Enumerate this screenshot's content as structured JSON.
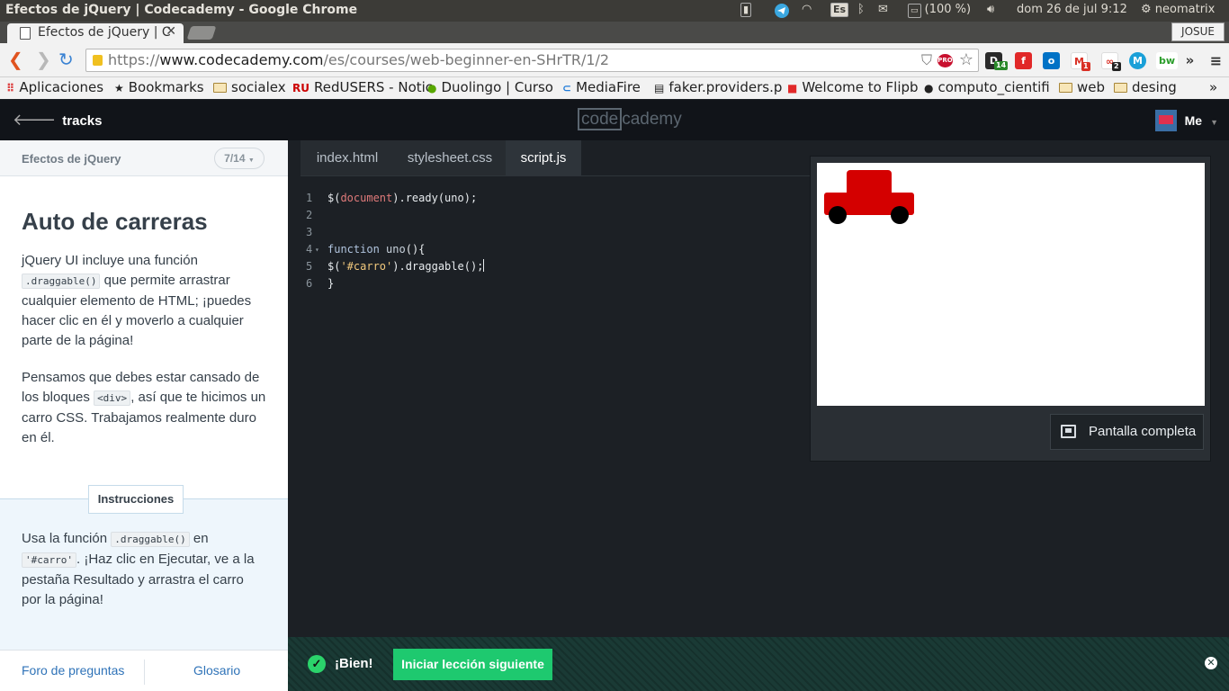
{
  "os": {
    "window_title": "Efectos de jQuery | Codecademy - Google Chrome",
    "lang_indicator": "Es",
    "battery": "(100 %)",
    "datetime": "dom 26 de jul  9:12",
    "user": "neomatrix"
  },
  "browser": {
    "tab_title": "Efectos de jQuery | C",
    "profile": "JOSUE",
    "url_scheme": "https://",
    "url_domain": "www.codecademy.com",
    "url_path": "/es/courses/web-beginner-en-SHrTR/1/2",
    "ext_d_badge": "14",
    "ext_gmail_badge": "1",
    "ext_chain_badge": "2",
    "ext_bw": "bw",
    "ext_pro": "PRO",
    "overflow": "»"
  },
  "bookmarks": [
    {
      "label": "Aplicaciones"
    },
    {
      "label": "Bookmarks"
    },
    {
      "label": "socialex"
    },
    {
      "label": "RedUSERS - Notic",
      "prefix": "RU"
    },
    {
      "label": "Duolingo | Curso"
    },
    {
      "label": "MediaFire"
    },
    {
      "label": "faker.providers.p"
    },
    {
      "label": "Welcome to Flipb"
    },
    {
      "label": "computo_cientifi"
    },
    {
      "label": "web"
    },
    {
      "label": "desing"
    }
  ],
  "cc": {
    "tracks_label": "tracks",
    "logo_left": "code",
    "logo_right": "cademy",
    "me_label": "Me"
  },
  "lesson": {
    "course_title": "Efectos de jQuery",
    "progress": "7/14",
    "title": "Auto de carreras",
    "p1_a": "jQuery UI incluye una función ",
    "p1_code": ".draggable()",
    "p1_b": " que permite arrastrar cualquier elemento de HTML; ¡puedes hacer clic en él y moverlo a cualquier parte de la página!",
    "p2_a": "Pensamos que debes estar cansado de los bloques ",
    "p2_code": "<div>",
    "p2_b": ", así que te hicimos un carro CSS. Trabajamos realmente duro en él.",
    "instructions_label": "Instrucciones",
    "i_a": "Usa la función ",
    "i_code1": ".draggable()",
    "i_b": " en ",
    "i_code2": "'#carro'",
    "i_c": ". ¡Haz clic en Ejecutar, ve a la pestaña Resultado y arrastra el carro por la página!",
    "forum_link": "Foro de preguntas",
    "glossary_link": "Glosario"
  },
  "editor": {
    "tabs": [
      {
        "label": "index.html"
      },
      {
        "label": "stylesheet.css"
      },
      {
        "label": "script.js"
      }
    ],
    "lines": [
      {
        "n": "1",
        "a": "$(",
        "b": "document",
        "c": ").ready(uno);"
      },
      {
        "n": "2"
      },
      {
        "n": "3"
      },
      {
        "n": "4",
        "a": "function ",
        "b": "uno",
        "c": "(){"
      },
      {
        "n": "5",
        "a": "$(",
        "b": "'#carro'",
        "c": ").draggable();"
      },
      {
        "n": "6",
        "a": "}"
      }
    ]
  },
  "preview": {
    "fullscreen_label": "Pantalla completa",
    "car_color": "#d40000"
  },
  "bottom": {
    "success_label": "¡Bien!",
    "next_label": "Iniciar lección siguiente"
  }
}
